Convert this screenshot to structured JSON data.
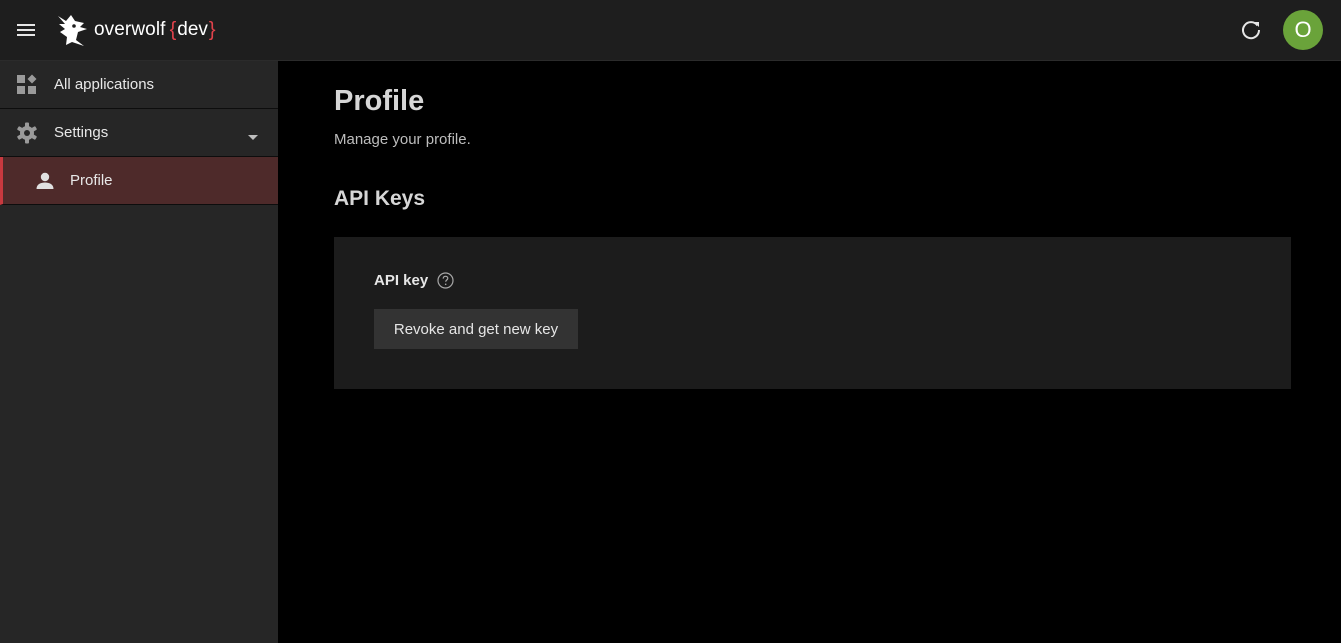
{
  "app": {
    "brand_name": "overwolf",
    "brand_brace_open": "{",
    "brand_tag": "dev",
    "brand_brace_close": "}",
    "accent_color": "#e0424b",
    "avatar_initial": "O",
    "avatar_color": "#6aa33a"
  },
  "icons": {
    "menu": "hamburger-menu-icon",
    "logo": "wolf-logo-icon",
    "refresh": "refresh-icon",
    "apps": "dashboard-grid-icon",
    "settings": "gear-icon",
    "caret": "caret-down-icon",
    "profile": "person-icon",
    "help": "question-circle-icon"
  },
  "sidebar": {
    "items": [
      {
        "label": "All applications"
      },
      {
        "label": "Settings",
        "expanded": true
      },
      {
        "label": "Profile",
        "selected": true
      }
    ]
  },
  "main": {
    "title": "Profile",
    "subtitle": "Manage your profile.",
    "section_title": "API Keys",
    "api_key_label": "API key",
    "revoke_button_label": "Revoke and get new key"
  }
}
